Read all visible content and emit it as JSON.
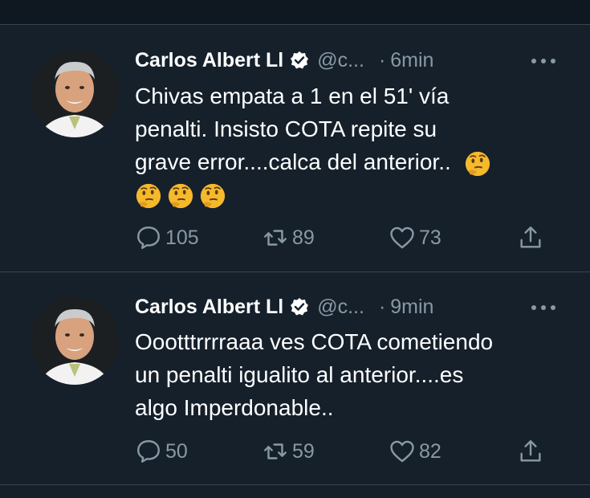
{
  "tweets": [
    {
      "name": "Carlos Albert Ll",
      "handle": "@c...",
      "separator": "·",
      "time": "6min",
      "text_lines": [
        "Chivas empata a 1 en el 51' vía",
        "penalti. Insisto COTA repite su",
        "grave error....calca del anterior.."
      ],
      "emoji": "thinking-face",
      "replies": "105",
      "retweets": "89",
      "likes": "73"
    },
    {
      "name": "Carlos Albert Ll",
      "handle": "@c...",
      "separator": "·",
      "time": "9min",
      "text_lines": [
        "Oootttrrrraaa ves COTA cometiendo",
        "un penalti igualito al anterior....es",
        "algo Imperdonable.."
      ],
      "replies": "50",
      "retweets": "59",
      "likes": "82"
    }
  ],
  "colors": {
    "background": "#15202b",
    "secondary_text": "#8899a6",
    "divider": "#38444d"
  }
}
